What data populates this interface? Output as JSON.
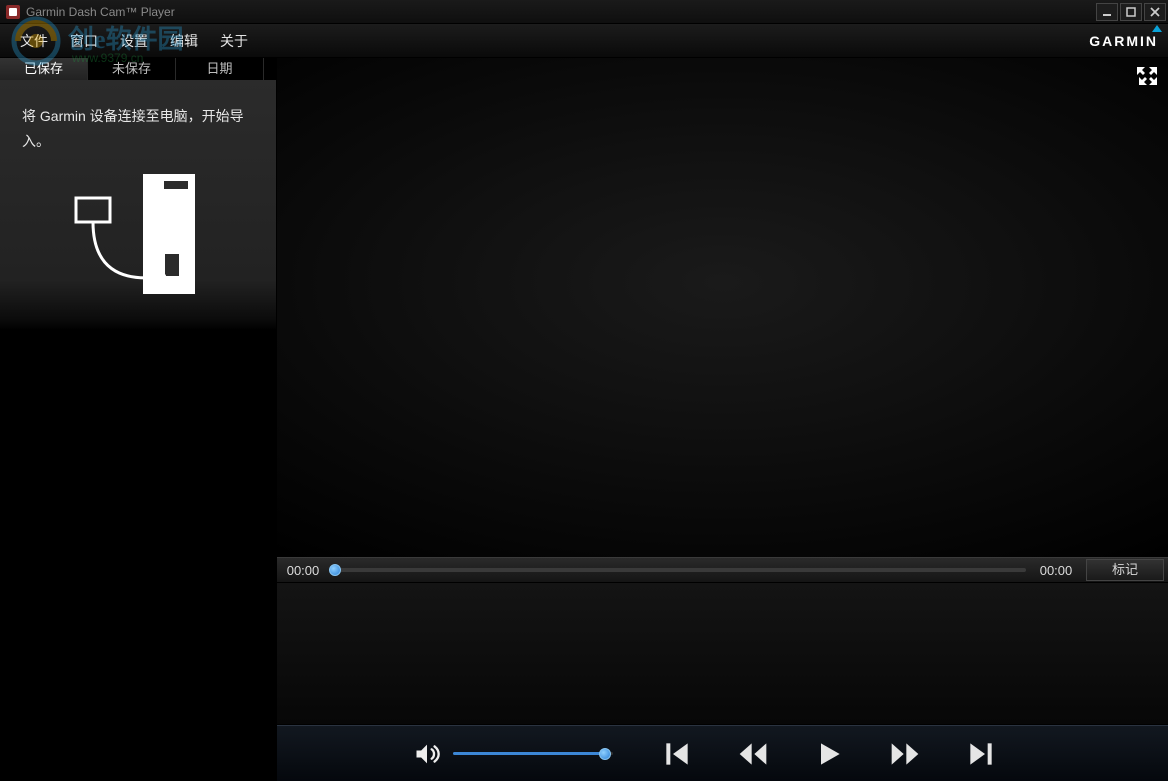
{
  "window": {
    "title": "Garmin Dash Cam™ Player"
  },
  "menu": {
    "items": [
      "文件",
      "窗口",
      "设置",
      "编辑",
      "关于"
    ]
  },
  "brand": {
    "logo_text": "GARMIN"
  },
  "sidebar": {
    "tabs": [
      "已保存",
      "未保存",
      "日期"
    ],
    "hint": "将 Garmin 设备连接至电脑，开始导入。"
  },
  "player": {
    "time_current": "00:00",
    "time_total": "00:00",
    "mark_label": "标记"
  }
}
